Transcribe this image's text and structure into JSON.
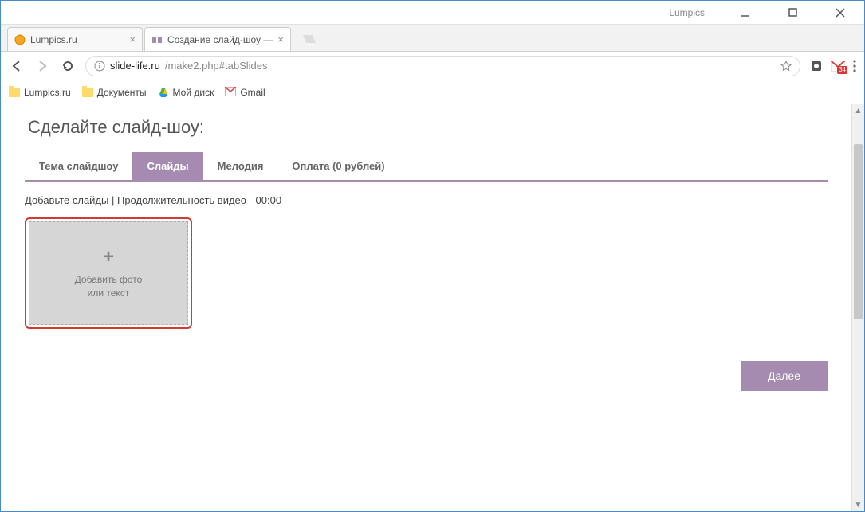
{
  "window": {
    "title": "Lumpics"
  },
  "browser_tabs": [
    {
      "title": "Lumpics.ru",
      "active": false,
      "favicon": "orange-circle"
    },
    {
      "title": "Создание слайд-шоу — ",
      "active": true,
      "favicon": "slidelife"
    }
  ],
  "address_bar": {
    "url_host": "slide-life.ru",
    "url_path": "/make2.php#tabSlides",
    "gmail_badge": "34"
  },
  "bookmarks": [
    {
      "label": "Lumpics.ru",
      "icon": "folder"
    },
    {
      "label": "Документы",
      "icon": "folder"
    },
    {
      "label": "Мой диск",
      "icon": "drive"
    },
    {
      "label": "Gmail",
      "icon": "gmail"
    }
  ],
  "page": {
    "title": "Сделайте слайд-шоу:",
    "tabs": [
      {
        "label": "Тема слайдшоу",
        "active": false
      },
      {
        "label": "Слайды",
        "active": true
      },
      {
        "label": "Мелодия",
        "active": false
      },
      {
        "label": "Оплата (0 рублей)",
        "active": false
      }
    ],
    "hint": "Добавьте слайды | Продолжительность видео - 00:00",
    "add_card": {
      "plus": "+",
      "line1": "Добавить фото",
      "line2": "или текст"
    },
    "next_button": "Далее"
  }
}
